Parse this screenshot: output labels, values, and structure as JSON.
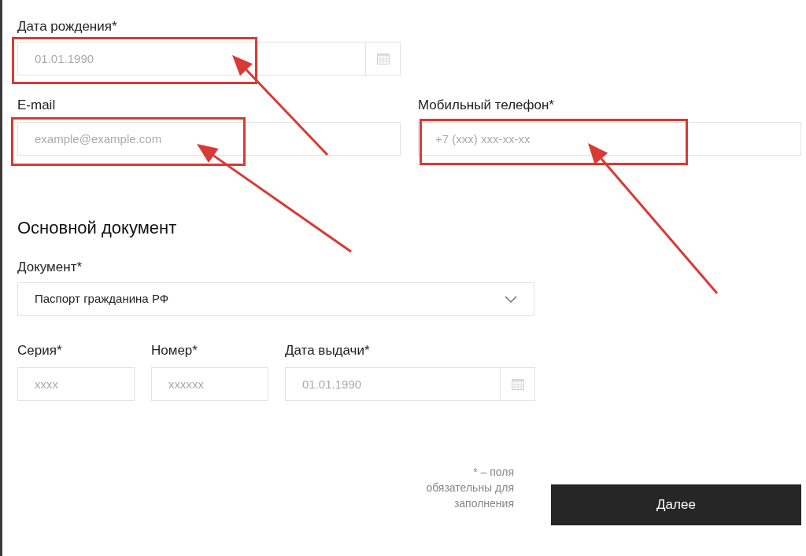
{
  "birth_date": {
    "label": "Дата рождения*",
    "placeholder": "01.01.1990"
  },
  "email": {
    "label": "E-mail",
    "placeholder": "example@example.com"
  },
  "phone": {
    "label": "Мобильный телефон*",
    "placeholder": "+7 (xxx) xxx-xx-xx"
  },
  "section_title": "Основной документ",
  "document": {
    "label": "Документ*",
    "value": "Паспорт гражданина РФ"
  },
  "series": {
    "label": "Серия*",
    "placeholder": "xxxx"
  },
  "number": {
    "label": "Номер*",
    "placeholder": "xxxxxx"
  },
  "issue_date": {
    "label": "Дата выдачи*",
    "placeholder": "01.01.1990"
  },
  "required_note": "* – поля обязательны для заполнения",
  "next_button": "Далее"
}
